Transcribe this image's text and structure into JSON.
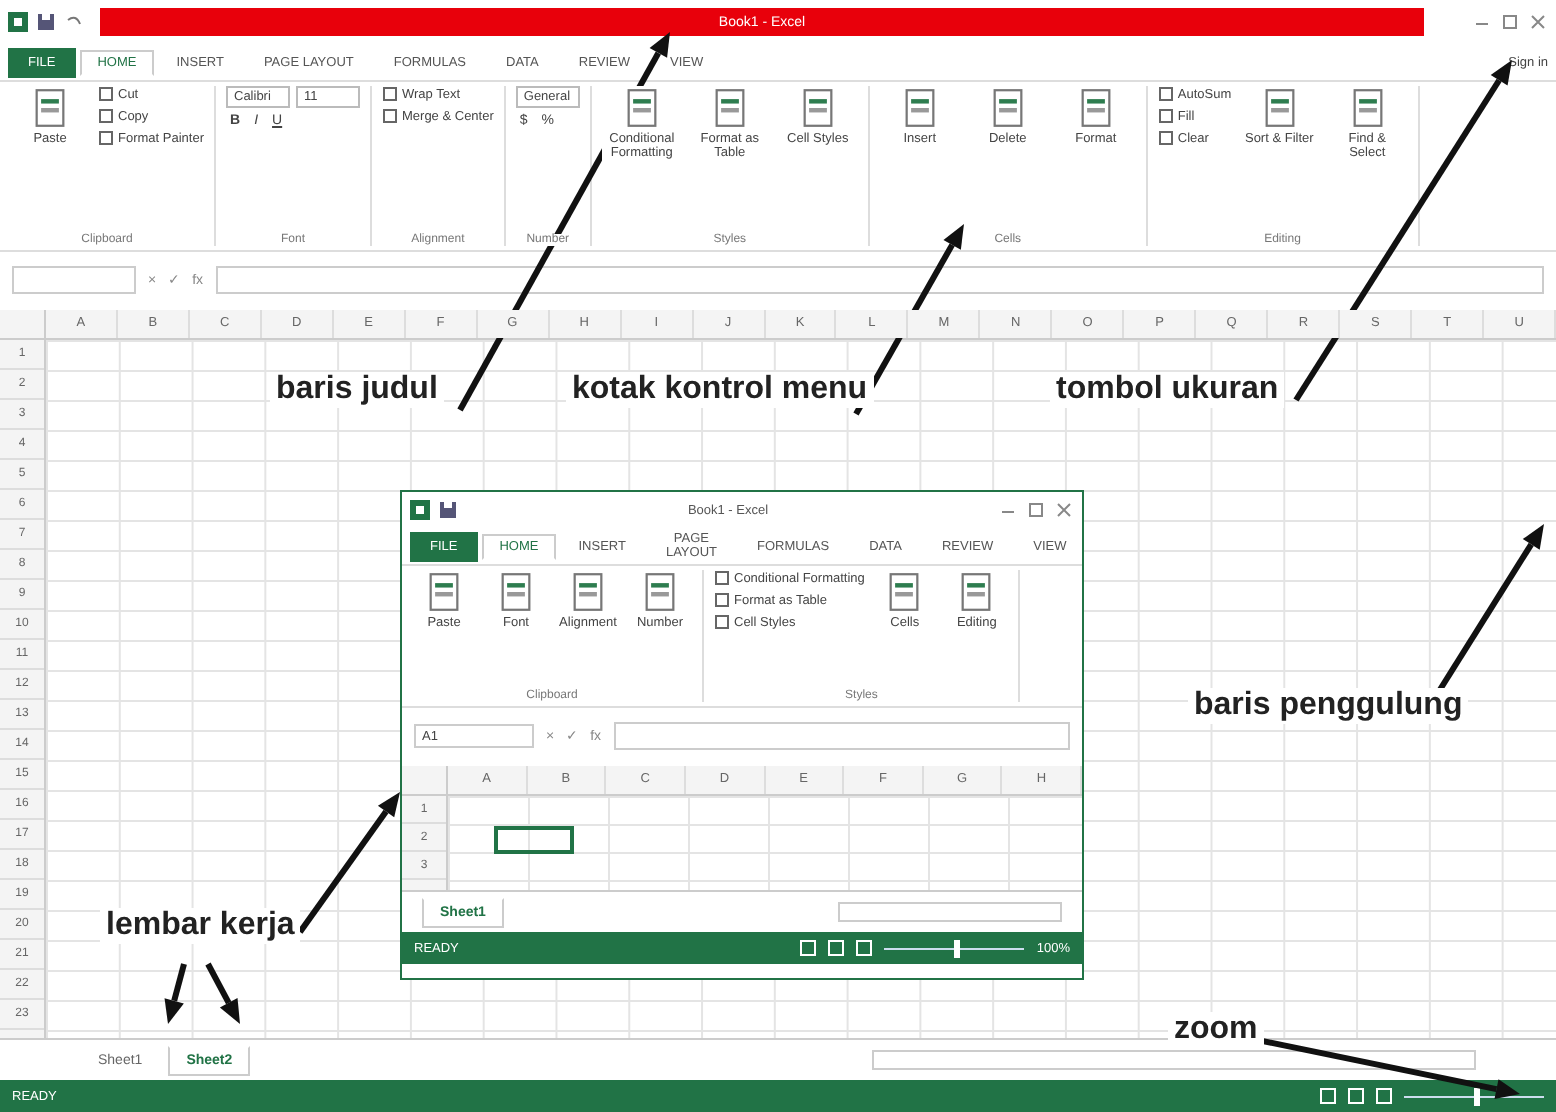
{
  "main": {
    "title_bar": {
      "title": "Book1 - Excel"
    },
    "tabs": [
      {
        "label": "FILE",
        "kind": "file",
        "selected": false
      },
      {
        "label": "HOME",
        "kind": "tab",
        "selected": true
      },
      {
        "label": "INSERT",
        "kind": "tab",
        "selected": false
      },
      {
        "label": "PAGE LAYOUT",
        "kind": "tab",
        "selected": false
      },
      {
        "label": "FORMULAS",
        "kind": "tab",
        "selected": false
      },
      {
        "label": "DATA",
        "kind": "tab",
        "selected": false
      },
      {
        "label": "REVIEW",
        "kind": "tab",
        "selected": false
      },
      {
        "label": "VIEW",
        "kind": "tab",
        "selected": false
      }
    ],
    "sign_in": "Sign in",
    "ribbon": [
      {
        "label": "Clipboard",
        "columns": [
          [
            {
              "kind": "big",
              "label": "Paste"
            }
          ],
          [
            {
              "kind": "small",
              "label": "Cut"
            },
            {
              "kind": "small",
              "label": "Copy"
            },
            {
              "kind": "small",
              "label": "Format Painter"
            }
          ]
        ]
      },
      {
        "label": "Font",
        "columns": [
          [
            {
              "kind": "row",
              "items": [
                {
                  "kind": "dropdown",
                  "label": "Calibri"
                },
                {
                  "kind": "dropdown",
                  "label": "11"
                }
              ]
            },
            {
              "kind": "row",
              "items": [
                {
                  "kind": "bold",
                  "label": "B"
                },
                {
                  "kind": "italic",
                  "label": "I"
                },
                {
                  "kind": "underline",
                  "label": "U"
                }
              ]
            }
          ]
        ]
      },
      {
        "label": "Alignment",
        "columns": [
          [
            {
              "kind": "small",
              "label": "Wrap Text"
            },
            {
              "kind": "small",
              "label": "Merge & Center"
            }
          ]
        ]
      },
      {
        "label": "Number",
        "columns": [
          [
            {
              "kind": "dropdown",
              "label": "General"
            },
            {
              "kind": "row",
              "items": [
                {
                  "kind": "currency",
                  "label": "$"
                },
                {
                  "kind": "percent",
                  "label": "%"
                }
              ]
            }
          ]
        ]
      },
      {
        "label": "Styles",
        "columns": [
          [
            {
              "kind": "big",
              "label": "Conditional Formatting"
            }
          ],
          [
            {
              "kind": "big",
              "label": "Format as Table"
            }
          ],
          [
            {
              "kind": "big",
              "label": "Cell Styles"
            }
          ]
        ]
      },
      {
        "label": "Cells",
        "columns": [
          [
            {
              "kind": "big",
              "label": "Insert"
            }
          ],
          [
            {
              "kind": "big",
              "label": "Delete"
            }
          ],
          [
            {
              "kind": "big",
              "label": "Format"
            }
          ]
        ]
      },
      {
        "label": "Editing",
        "columns": [
          [
            {
              "kind": "small",
              "label": "AutoSum"
            },
            {
              "kind": "small",
              "label": "Fill"
            },
            {
              "kind": "small",
              "label": "Clear"
            }
          ],
          [
            {
              "kind": "big",
              "label": "Sort & Filter"
            }
          ],
          [
            {
              "kind": "big",
              "label": "Find & Select"
            }
          ]
        ]
      }
    ],
    "formula_bar": {
      "cancel": "×",
      "enter": "✓",
      "function": "fx"
    },
    "columns": [
      "A",
      "B",
      "C",
      "D",
      "E",
      "F",
      "G",
      "H",
      "I",
      "J",
      "K",
      "L",
      "M",
      "N",
      "O",
      "P",
      "Q",
      "R",
      "S",
      "T",
      "U"
    ],
    "rows": [
      "1",
      "2",
      "3",
      "4",
      "5",
      "6",
      "7",
      "8",
      "9",
      "10",
      "11",
      "12",
      "13",
      "14",
      "15",
      "16",
      "17",
      "18",
      "19",
      "20",
      "21",
      "22",
      "23"
    ],
    "sheets": [
      {
        "label": "Sheet1",
        "selected": false
      },
      {
        "label": "Sheet2",
        "selected": true
      }
    ],
    "status": "READY",
    "zoom": {
      "level": 0.5
    }
  },
  "inner": {
    "title_bar": {
      "title": "Book1 - Excel"
    },
    "tabs": [
      {
        "label": "FILE",
        "kind": "file",
        "selected": false
      },
      {
        "label": "HOME",
        "kind": "tab",
        "selected": true
      },
      {
        "label": "INSERT",
        "kind": "tab",
        "selected": false
      },
      {
        "label": "PAGE LAYOUT",
        "kind": "tab",
        "selected": false
      },
      {
        "label": "FORMULAS",
        "kind": "tab",
        "selected": false
      },
      {
        "label": "DATA",
        "kind": "tab",
        "selected": false
      },
      {
        "label": "REVIEW",
        "kind": "tab",
        "selected": false
      },
      {
        "label": "VIEW",
        "kind": "tab",
        "selected": false
      }
    ],
    "ribbon": [
      {
        "label": "Clipboard",
        "columns": [
          [
            {
              "kind": "big",
              "label": "Paste"
            }
          ],
          [
            {
              "kind": "big",
              "label": "Font"
            }
          ],
          [
            {
              "kind": "big",
              "label": "Alignment"
            }
          ],
          [
            {
              "kind": "big",
              "label": "Number"
            }
          ]
        ]
      },
      {
        "label": "Styles",
        "columns": [
          [
            {
              "kind": "small",
              "label": "Conditional Formatting"
            },
            {
              "kind": "small",
              "label": "Format as Table"
            },
            {
              "kind": "small",
              "label": "Cell Styles"
            }
          ],
          [
            {
              "kind": "big",
              "label": "Cells"
            }
          ],
          [
            {
              "kind": "big",
              "label": "Editing"
            }
          ]
        ]
      }
    ],
    "name_box": "A1",
    "formula_bar": {
      "cancel": "×",
      "enter": "✓",
      "function": "fx"
    },
    "columns": [
      "A",
      "B",
      "C",
      "D",
      "E",
      "F",
      "G",
      "H"
    ],
    "rows": [
      "1",
      "2",
      "3"
    ],
    "sheets": [
      {
        "label": "Sheet1",
        "selected": true
      }
    ],
    "status": "READY",
    "zoom": {
      "level": 0.5,
      "reading": "100%"
    }
  },
  "annotations": [
    {
      "text": "baris judul",
      "kind": "title"
    },
    {
      "text": "kotak kontrol menu",
      "kind": "ribbon"
    },
    {
      "text": "tombol ukuran",
      "kind": "size"
    },
    {
      "text": "baris penggulung",
      "kind": "scroll"
    },
    {
      "text": "lembar kerja",
      "kind": "sheet"
    },
    {
      "text": "zoom",
      "kind": "zoom"
    }
  ]
}
